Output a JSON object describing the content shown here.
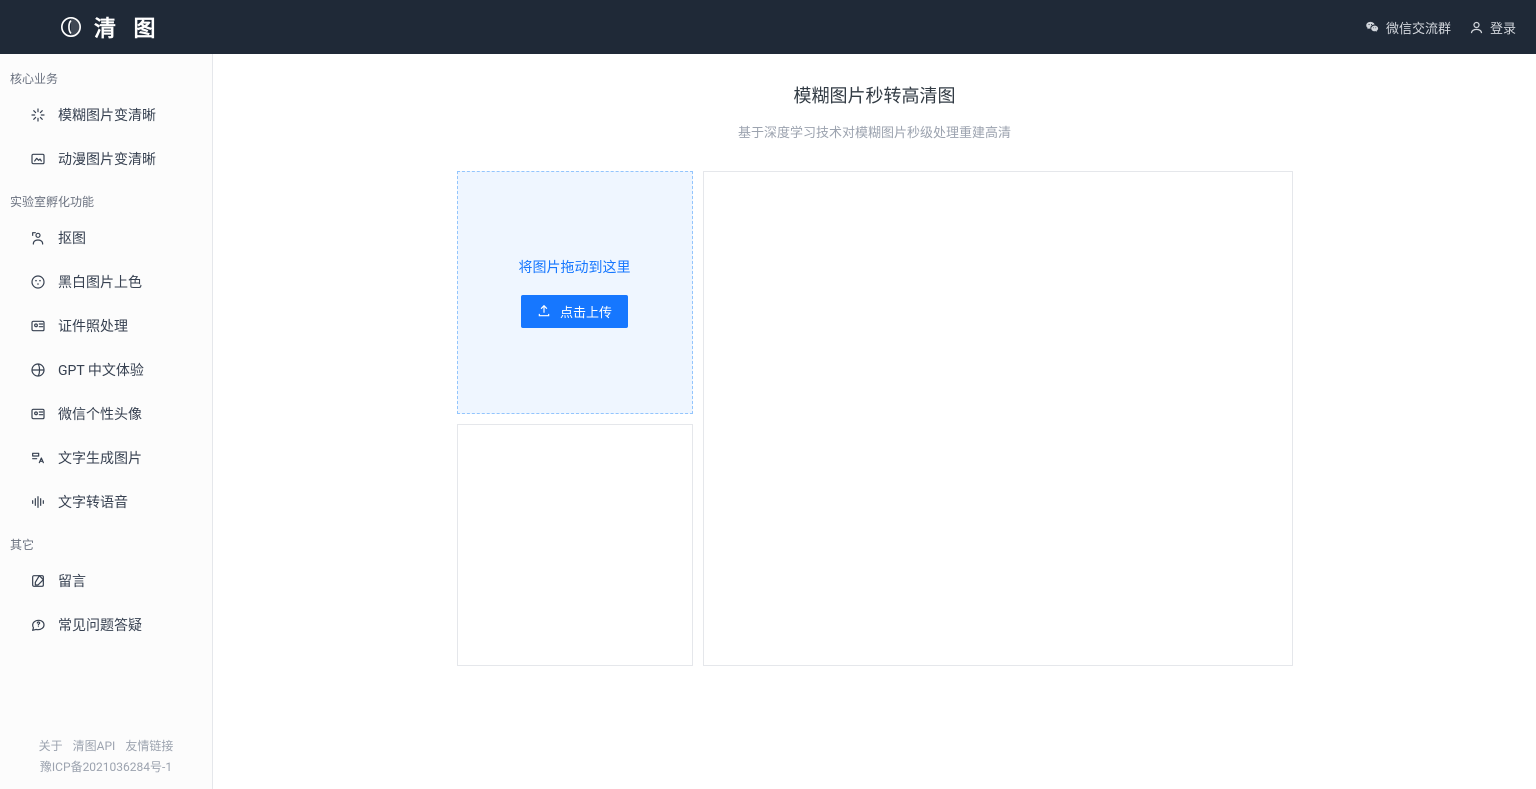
{
  "brand": {
    "name": "清 图"
  },
  "header": {
    "wechat_link": "微信交流群",
    "login": "登录"
  },
  "sidebar": {
    "groups": [
      {
        "label": "核心业务",
        "items": [
          {
            "icon": "enhance-icon",
            "label": "模糊图片变清晰"
          },
          {
            "icon": "anime-icon",
            "label": "动漫图片变清晰"
          }
        ]
      },
      {
        "label": "实验室孵化功能",
        "items": [
          {
            "icon": "cutout-icon",
            "label": "抠图"
          },
          {
            "icon": "colorize-icon",
            "label": "黑白图片上色"
          },
          {
            "icon": "idphoto-icon",
            "label": "证件照处理"
          },
          {
            "icon": "gpt-icon",
            "label": "GPT 中文体验"
          },
          {
            "icon": "avatar-icon",
            "label": "微信个性头像"
          },
          {
            "icon": "text2img-icon",
            "label": "文字生成图片"
          },
          {
            "icon": "tts-icon",
            "label": "文字转语音"
          }
        ]
      },
      {
        "label": "其它",
        "items": [
          {
            "icon": "feedback-icon",
            "label": "留言"
          },
          {
            "icon": "faq-icon",
            "label": "常见问题答疑"
          }
        ]
      }
    ],
    "footer": {
      "links": [
        "关于",
        "清图API",
        "友情链接"
      ],
      "icp": "豫ICP备2021036284号-1"
    }
  },
  "main": {
    "title": "模糊图片秒转高清图",
    "subtitle": "基于深度学习技术对模糊图片秒级处理重建高清",
    "dropzone_text": "将图片拖动到这里",
    "upload_button": "点击上传"
  }
}
